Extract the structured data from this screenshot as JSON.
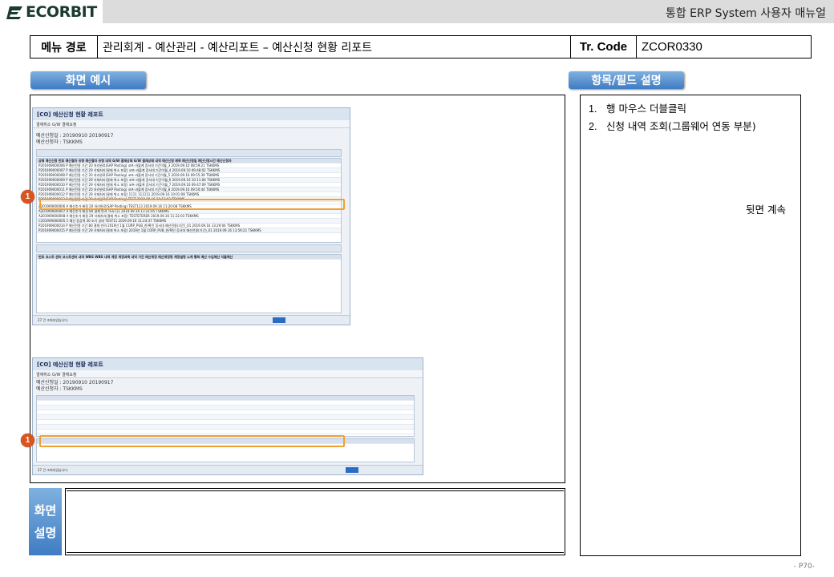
{
  "header": {
    "logo_text": "ECORBIT",
    "manual_title": "통합 ERP System 사용자 매뉴얼"
  },
  "menu": {
    "label": "메뉴 경로",
    "path": "관리회계 - 예산관리 - 예산리포트 – 예산신청 현황 리포트",
    "tr_code_label": "Tr. Code",
    "tr_code_value": "ZCOR0330"
  },
  "sections": {
    "screen_example": "화면 예시",
    "field_description": "항목/필드 설명",
    "screen_description_line1": "화면",
    "screen_description_line2": "설명"
  },
  "fields": [
    {
      "num": "1.",
      "text": "행 마우스 더블클릭"
    },
    {
      "num": "2.",
      "text": "신청 내역 조회(그룹웨어 연동 부분)"
    }
  ],
  "continued": "뒷면 계속",
  "page_number": "- P70-",
  "screenshot1": {
    "title": "[CO] 예산신청 현황 레포트",
    "toolbar": "결재취소   G/W 결재요청",
    "meta1": "예산신청일 : 20190910 20190917",
    "meta2": "예산신청자 : TSKKMS",
    "marker": "1",
    "columns": "상태 예산신청 번호 예산절차 유형 예산절차 유형 내역 G/W 결재상태 G/W 결재상태 내역 예산신청 제목 예산신청일 예산신청시간 예산신청자",
    "rows": [
      "P201909000006 P 예산전용 기간 20 처리완료(SAP Posting) 코프-과불계 증서대 기간이월_3 2019.09.10 08:59:21 TSKKMS",
      "P201909000007 P 예산전용 기간 29 삭제처리(결재 취소 포함) 코프-과불계 증서대 기간이월_4 2019.09.10 09:48:02 TSKKMS",
      "P201909000008 P 예산전용 기간 20 처리완료(SAP Posting) 코프-과불계 증서대 기간이월_5 2019.09.10 09:55:39 TSKKMS",
      "P201909000009 P 예산전용 기간 29 삭제처리(결재 취소 포함) 코프-과불계 증서대 기간이월_6 2019.09.16 10:11:06 TSKKMS",
      "P201909000010 P 예산전용 기간 29 삭제처리(결재 취소 포함) 코프-과불계 증서대 기간이월_7 2019.09.16 09:47:09 TSKKMS",
      "P201909000011 P 예산전용 기간 20 처리완료(SAP Posting) 코프-과불계 증서대 기간이월_8 2019.09.16 09:50:44 TSKKMS",
      "P201909000012 P 예산전용 기간 29 삭제처리(결재 취소 포함) 1111 111111 2019.09.16 10:01:08 TSKKMS",
      "P201909000013 P 예산전용 기간 20 처리완료(SAP Posting) TEST 2019.09.16 10:12:03 TSKKMS",
      "A201909000006 A 예산추가 배정 20 처리완료(SAP Posting) TEST113 2019.09.16 11:20:08 TSKKMS",
      "A201909000007 A 예산추가 배정 80 결재 반려 TEST11 2019.09.16 11:21:05 TSKKMS",
      "A201909000008 A 예산추가 배정 29 삭제처리(결재 취소 포함) TESTETERER 2019.09.16 11:22:03 TSKKMS",
      "C201909000005 C 예산 증감액 30 조기 상태 TEST11 2019.09.16 11:24:37 TSKKMS",
      "P201909000014 P 예산전용 기간 80 결재 반려 2019년 1월 CORP_PUB_한/확인 증서대 예산전용(기간)_01 2019.09.16 13:29:04 TSKKMS",
      "P201909000015 P 예산전용 기간 29 삭제처리(결재 취소 포함) 2019년 1월 CORP_PUB_한/확인 증서대 예산전용(기간)_01 2019.09.16 13:59:21 TSKKMS"
    ],
    "detail_columns": "번호 코스트 센터 코스트센터 내역 WBS WBS 내역 계정 계정과목 내역 기간 예산계정 예산계정명 계정설명 소계 통화 예산 수입예산 지출예산",
    "status": "27 건 조회되었습니다."
  },
  "screenshot2": {
    "title": "[CO] 예산신청 현황 레포트",
    "toolbar": "결재취소   G/W 결재요청",
    "meta1": "예산신청일 : 20190910 20190917",
    "meta2": "예산신청자 : TSKKMS",
    "marker": "1",
    "status": "27 건 조회되었습니다."
  }
}
